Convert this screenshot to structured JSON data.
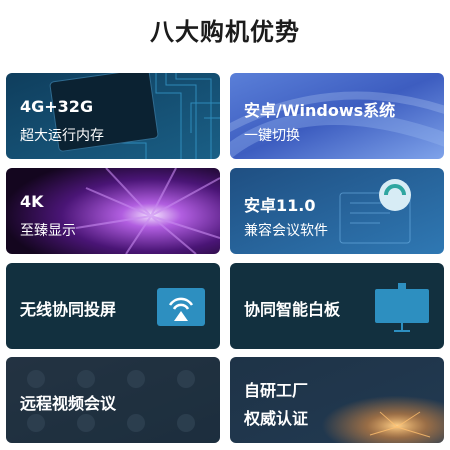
{
  "page": {
    "title": "八大购机优势"
  },
  "cards": [
    {
      "line1": "4G+32G",
      "line2": "超大运行内存",
      "bg_icon": "chip-icon"
    },
    {
      "line1": "安卓/Windows系统",
      "line2": "一键切换",
      "bg_icon": "windows-swirl-icon"
    },
    {
      "line1": "4K",
      "line2": "至臻显示",
      "bg_icon": "purple-flower-icon"
    },
    {
      "line1": "安卓11.0",
      "line2": "兼容会议软件",
      "bg_icon": "software-cube-icon"
    },
    {
      "line1": "无线协同投屏",
      "icon": "screen-cast-icon"
    },
    {
      "line1": "协同智能白板",
      "icon": "whiteboard-icon"
    },
    {
      "line1": "远程视频会议",
      "bg_icon": "video-grid-icon"
    },
    {
      "line1": "自研工厂",
      "line2": "权威认证",
      "bg_icon": "factory-sparks-icon"
    }
  ],
  "colors": {
    "title": "#1b1b1b",
    "card_dark": "#12303f",
    "accent_blue": "#2d8fc0"
  }
}
